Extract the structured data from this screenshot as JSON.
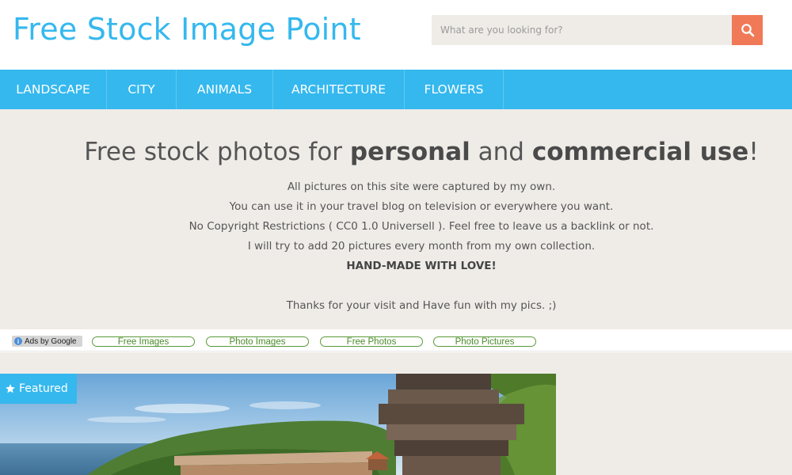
{
  "header": {
    "site_title": "Free Stock Image Point",
    "search_placeholder": "What are you looking for?"
  },
  "nav": {
    "items": [
      {
        "label": "LANDSCAPE"
      },
      {
        "label": "CITY"
      },
      {
        "label": "ANIMALS"
      },
      {
        "label": "ARCHITECTURE"
      },
      {
        "label": "FLOWERS"
      }
    ]
  },
  "hero": {
    "title_pre": "Free stock photos for ",
    "title_bold1": "personal",
    "title_mid": " and ",
    "title_bold2": "commercial use",
    "title_end": "!",
    "lines": [
      "All pictures on this site were captured by my own.",
      "You can use it in your travel blog on television or everywhere you want.",
      "No Copyright Restrictions ( CC0 1.0 Universell ). Feel free to leave us a backlink or not.",
      "I will try to add 20 pictures every month from my own collection."
    ],
    "strong_line": "HAND-MADE WITH LOVE!",
    "thanks": "Thanks for your visit and Have fun with my pics. ;)"
  },
  "ads": {
    "label": "Ads by Google",
    "links": [
      "Free Images",
      "Photo Images",
      "Free Photos",
      "Photo Pictures"
    ]
  },
  "featured": {
    "badge": "Featured"
  },
  "colors": {
    "accent": "#35b8ee",
    "search_button": "#f07a58",
    "hero_bg": "#efece8"
  },
  "icons": {
    "search": "search-icon",
    "star": "star-icon",
    "info": "info-icon"
  }
}
